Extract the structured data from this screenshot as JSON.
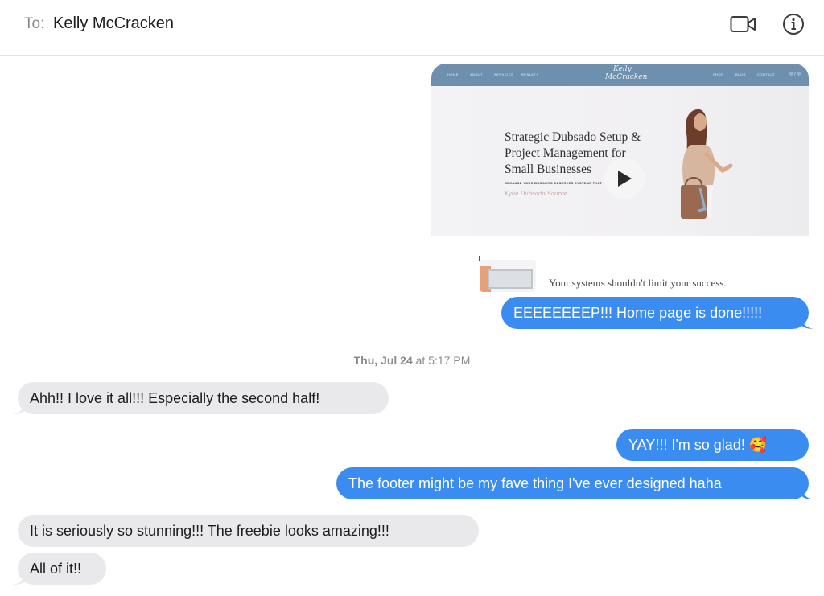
{
  "header": {
    "to_label": "To:",
    "recipient": "Kelly McCracken",
    "icons": [
      "video-call-icon",
      "info-icon"
    ]
  },
  "preview": {
    "nav_left": [
      "HOME",
      "ABOUT",
      "SERVICES",
      "RESULTS"
    ],
    "nav_right": [
      "SHOP",
      "BLOG",
      "CONTACT"
    ],
    "logo_line1": "Kelly",
    "logo_line2": "McCracken",
    "headline_1": "Strategic Dubsado Setup &",
    "headline_2": "Project Management for",
    "headline_3": "Small Businesses",
    "tagline": "BECAUSE YOUR BUSINESS DESERVES SYSTEMS THAT",
    "signature": "Kylie Dubsado Source",
    "caption": "Your systems shouldn't limit your success."
  },
  "messages": [
    {
      "from": "me",
      "text": "EEEEEEEEP!!! Home page is done!!!!!"
    },
    {
      "from": "them",
      "text": "Ahh!! I love it all!!! Especially the second half!"
    },
    {
      "from": "me",
      "text": "YAY!!! I'm so glad! 🥰"
    },
    {
      "from": "me",
      "text": "The footer might be my fave thing I've ever designed haha"
    },
    {
      "from": "them",
      "text": "It is seriously so stunning!!! The freebie looks amazing!!!"
    },
    {
      "from": "them",
      "text": "All of it!!"
    }
  ],
  "timestamp": {
    "day": "Thu, Jul 24",
    "at": "at",
    "time": "5:17 PM"
  },
  "colors": {
    "sent": "#3b8cf0",
    "received": "#e9e9eb",
    "preview_nav": "#6f8fae"
  }
}
